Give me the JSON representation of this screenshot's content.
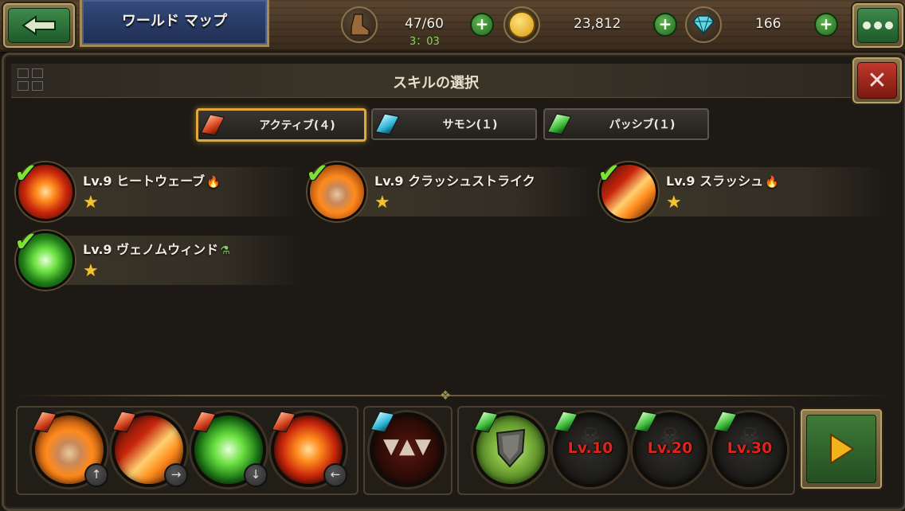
{
  "header": {
    "title": "ワールド マップ",
    "stamina": "47/60",
    "stamina_timer": "3：03",
    "gold": "23,812",
    "gems": "166",
    "back_icon": "back-arrow-icon",
    "menu_icon": "more-dots-icon"
  },
  "dialog": {
    "title": "スキルの選択",
    "tabs": [
      {
        "label": "アクティブ(４)",
        "gem": "red"
      },
      {
        "label": "サモン(１)",
        "gem": "cyan"
      },
      {
        "label": "パッシブ(１)",
        "gem": "green"
      }
    ],
    "skills": [
      {
        "name": "Lv.9 ヒートウェーブ",
        "tag": "fire",
        "tag_glyph": "🔥",
        "stars": "★"
      },
      {
        "name": "Lv.9 クラッシュストライク",
        "tag": "",
        "tag_glyph": "",
        "stars": "★"
      },
      {
        "name": "Lv.9 スラッシュ",
        "tag": "fire",
        "tag_glyph": "🔥",
        "stars": "★"
      },
      {
        "name": "Lv.9 ヴェノムウィンド",
        "tag": "poison",
        "tag_glyph": "⚗",
        "stars": "★"
      }
    ]
  },
  "tray": {
    "active_slots": [
      {
        "icon": "fist-skill-icon",
        "arrow": "↑"
      },
      {
        "icon": "sword-slash-skill-icon",
        "arrow": "→"
      },
      {
        "icon": "venom-blade-skill-icon",
        "arrow": "↓"
      },
      {
        "icon": "fire-wave-skill-icon",
        "arrow": "←"
      }
    ],
    "summon_slot": {
      "icon": "monster-maw-icon"
    },
    "passive_slots": [
      {
        "icon": "shield-skill-icon",
        "locked_label": ""
      },
      {
        "icon": "skull-lock-icon",
        "locked_label": "Lv.10"
      },
      {
        "icon": "skull-lock-icon",
        "locked_label": "Lv.20"
      },
      {
        "icon": "skull-lock-icon",
        "locked_label": "Lv.30"
      }
    ],
    "next_icon": "play-arrow-icon"
  },
  "colors": {
    "accent_gold": "#e0a73a",
    "check_green": "#7ee234",
    "locked_red": "#e3221a",
    "star_gold": "#f2c230"
  }
}
